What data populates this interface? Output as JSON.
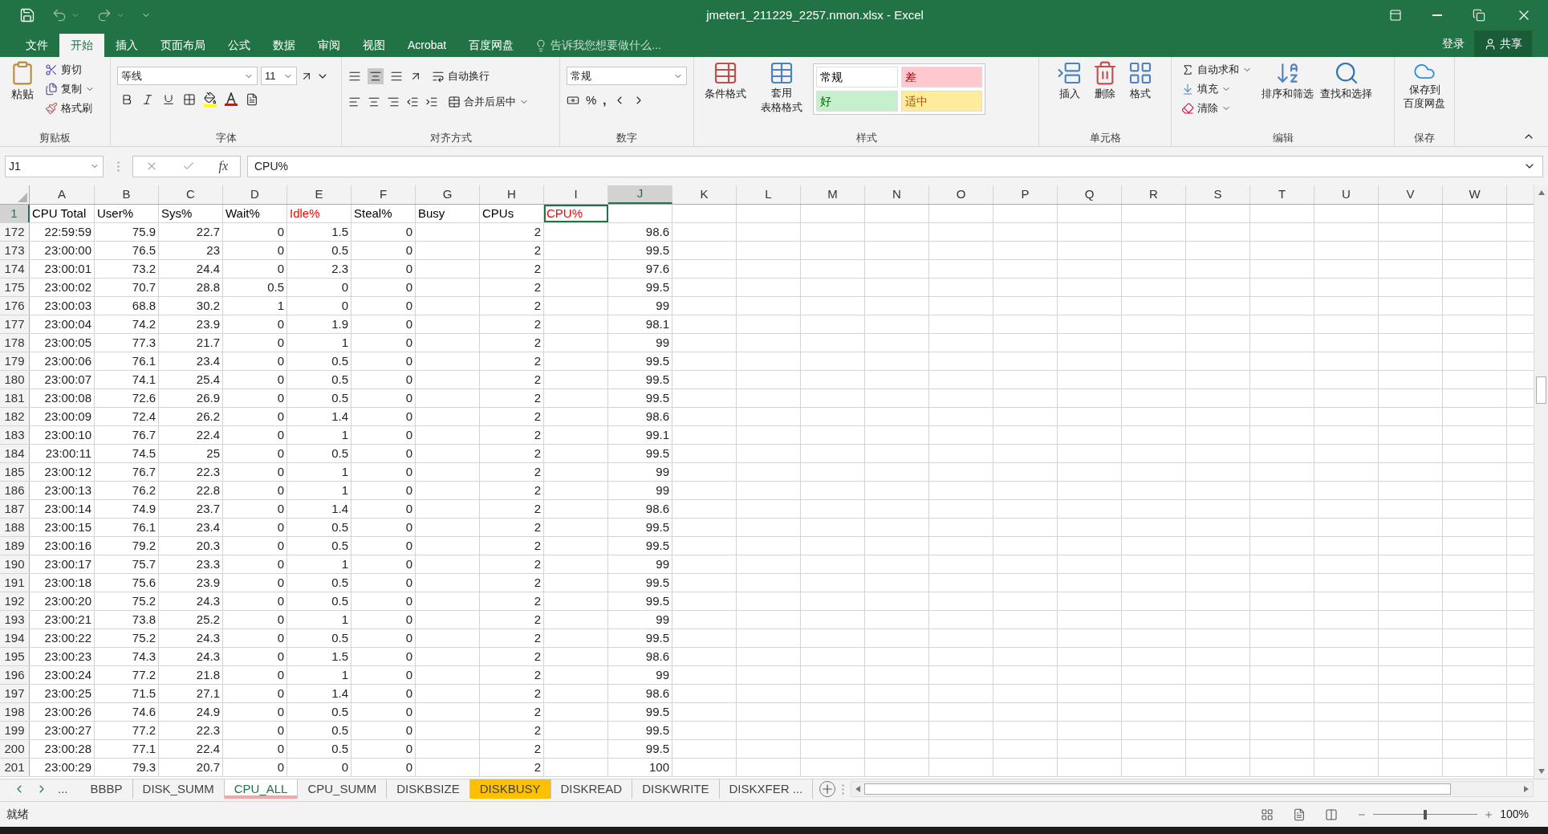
{
  "window": {
    "title": "jmeter1_211229_2257.nmon.xlsx - Excel"
  },
  "menu_tabs": [
    {
      "label": "文件",
      "selected": false
    },
    {
      "label": "开始",
      "selected": true
    },
    {
      "label": "插入",
      "selected": false
    },
    {
      "label": "页面布局",
      "selected": false
    },
    {
      "label": "公式",
      "selected": false
    },
    {
      "label": "数据",
      "selected": false
    },
    {
      "label": "审阅",
      "selected": false
    },
    {
      "label": "视图",
      "selected": false
    },
    {
      "label": "Acrobat",
      "selected": false
    },
    {
      "label": "百度网盘",
      "selected": false
    }
  ],
  "tell_me": {
    "placeholder": "告诉我您想要做什么..."
  },
  "account": {
    "sign_in": "登录",
    "share": "共享"
  },
  "ribbon": {
    "clipboard": {
      "paste": "粘贴",
      "cut": "剪切",
      "copy": "复制",
      "format_painter": "格式刷",
      "label": "剪贴板"
    },
    "font": {
      "name": "等线",
      "size": "11",
      "label": "字体"
    },
    "alignment": {
      "wrap": "自动换行",
      "merge": "合并后居中",
      "label": "对齐方式"
    },
    "number": {
      "format": "常规",
      "percent": "%",
      "comma": ",",
      "label": "数字"
    },
    "styles": {
      "conditional": "条件格式",
      "table": [
        "套用",
        "表格格式"
      ],
      "label": "样式",
      "cells": [
        {
          "label": "常规",
          "color": "#ffffff"
        },
        {
          "label": "差",
          "color": "#ffc7ce"
        },
        {
          "label": "好",
          "color": "#c6efce"
        },
        {
          "label": "适中",
          "color": "#ffeb9c"
        }
      ]
    },
    "cells": {
      "insert": "插入",
      "delete": "删除",
      "format": "格式",
      "label": "单元格"
    },
    "editing": {
      "autosum": "自动求和",
      "fill": "填充",
      "clear": "清除",
      "sort": "排序和筛选",
      "find": "查找和选择",
      "label": "编辑"
    },
    "save": {
      "button": [
        "保存到",
        "百度网盘"
      ],
      "label": "保存"
    }
  },
  "formula_bar": {
    "name_box": "J1",
    "fx": "fx",
    "value": "CPU%"
  },
  "sheet": {
    "columns": [
      {
        "label": "A",
        "selected": false
      },
      {
        "label": "B",
        "selected": false
      },
      {
        "label": "C",
        "selected": false
      },
      {
        "label": "D",
        "selected": false
      },
      {
        "label": "E",
        "selected": false
      },
      {
        "label": "F",
        "selected": false
      },
      {
        "label": "G",
        "selected": false
      },
      {
        "label": "H",
        "selected": false
      },
      {
        "label": "I",
        "selected": false
      },
      {
        "label": "J",
        "selected": true
      },
      {
        "label": "K",
        "selected": false
      },
      {
        "label": "L",
        "selected": false
      },
      {
        "label": "M",
        "selected": false
      },
      {
        "label": "N",
        "selected": false
      },
      {
        "label": "O",
        "selected": false
      },
      {
        "label": "P",
        "selected": false
      },
      {
        "label": "Q",
        "selected": false
      },
      {
        "label": "R",
        "selected": false
      },
      {
        "label": "S",
        "selected": false
      },
      {
        "label": "T",
        "selected": false
      },
      {
        "label": "U",
        "selected": false
      },
      {
        "label": "V",
        "selected": false
      },
      {
        "label": "W",
        "selected": false
      }
    ],
    "header_row": {
      "number": "1",
      "cells": [
        {
          "text": "CPU Total",
          "color": "#000000",
          "selected": false
        },
        {
          "text": "User%",
          "color": "#000000",
          "selected": false
        },
        {
          "text": "Sys%",
          "color": "#000000",
          "selected": false
        },
        {
          "text": "Wait%",
          "color": "#000000",
          "selected": false
        },
        {
          "text": "Idle%",
          "color": "#ff0000",
          "selected": false
        },
        {
          "text": "Steal%",
          "color": "#000000",
          "selected": false
        },
        {
          "text": "Busy",
          "color": "#000000",
          "selected": false
        },
        {
          "text": "CPUs",
          "color": "#000000",
          "selected": false
        },
        {
          "text": "CPU%",
          "color": "#ff0000",
          "selected": true
        }
      ]
    },
    "rows": [
      {
        "number": "172",
        "cells": [
          "22:59:59",
          "75.9",
          "22.7",
          "0",
          "1.5",
          "0",
          "2",
          "98.6"
        ]
      },
      {
        "number": "173",
        "cells": [
          "23:00:00",
          "76.5",
          "23",
          "0",
          "0.5",
          "0",
          "2",
          "99.5"
        ]
      },
      {
        "number": "174",
        "cells": [
          "23:00:01",
          "73.2",
          "24.4",
          "0",
          "2.3",
          "0",
          "2",
          "97.6"
        ]
      },
      {
        "number": "175",
        "cells": [
          "23:00:02",
          "70.7",
          "28.8",
          "0.5",
          "0",
          "0",
          "2",
          "99.5"
        ]
      },
      {
        "number": "176",
        "cells": [
          "23:00:03",
          "68.8",
          "30.2",
          "1",
          "0",
          "0",
          "2",
          "99"
        ]
      },
      {
        "number": "177",
        "cells": [
          "23:00:04",
          "74.2",
          "23.9",
          "0",
          "1.9",
          "0",
          "2",
          "98.1"
        ]
      },
      {
        "number": "178",
        "cells": [
          "23:00:05",
          "77.3",
          "21.7",
          "0",
          "1",
          "0",
          "2",
          "99"
        ]
      },
      {
        "number": "179",
        "cells": [
          "23:00:06",
          "76.1",
          "23.4",
          "0",
          "0.5",
          "0",
          "2",
          "99.5"
        ]
      },
      {
        "number": "180",
        "cells": [
          "23:00:07",
          "74.1",
          "25.4",
          "0",
          "0.5",
          "0",
          "2",
          "99.5"
        ]
      },
      {
        "number": "181",
        "cells": [
          "23:00:08",
          "72.6",
          "26.9",
          "0",
          "0.5",
          "0",
          "2",
          "99.5"
        ]
      },
      {
        "number": "182",
        "cells": [
          "23:00:09",
          "72.4",
          "26.2",
          "0",
          "1.4",
          "0",
          "2",
          "98.6"
        ]
      },
      {
        "number": "183",
        "cells": [
          "23:00:10",
          "76.7",
          "22.4",
          "0",
          "1",
          "0",
          "2",
          "99.1"
        ]
      },
      {
        "number": "184",
        "cells": [
          "23:00:11",
          "74.5",
          "25",
          "0",
          "0.5",
          "0",
          "2",
          "99.5"
        ]
      },
      {
        "number": "185",
        "cells": [
          "23:00:12",
          "76.7",
          "22.3",
          "0",
          "1",
          "0",
          "2",
          "99"
        ]
      },
      {
        "number": "186",
        "cells": [
          "23:00:13",
          "76.2",
          "22.8",
          "0",
          "1",
          "0",
          "2",
          "99"
        ]
      },
      {
        "number": "187",
        "cells": [
          "23:00:14",
          "74.9",
          "23.7",
          "0",
          "1.4",
          "0",
          "2",
          "98.6"
        ]
      },
      {
        "number": "188",
        "cells": [
          "23:00:15",
          "76.1",
          "23.4",
          "0",
          "0.5",
          "0",
          "2",
          "99.5"
        ]
      },
      {
        "number": "189",
        "cells": [
          "23:00:16",
          "79.2",
          "20.3",
          "0",
          "0.5",
          "0",
          "2",
          "99.5"
        ]
      },
      {
        "number": "190",
        "cells": [
          "23:00:17",
          "75.7",
          "23.3",
          "0",
          "1",
          "0",
          "2",
          "99"
        ]
      },
      {
        "number": "191",
        "cells": [
          "23:00:18",
          "75.6",
          "23.9",
          "0",
          "0.5",
          "0",
          "2",
          "99.5"
        ]
      },
      {
        "number": "192",
        "cells": [
          "23:00:20",
          "75.2",
          "24.3",
          "0",
          "0.5",
          "0",
          "2",
          "99.5"
        ]
      },
      {
        "number": "193",
        "cells": [
          "23:00:21",
          "73.8",
          "25.2",
          "0",
          "1",
          "0",
          "2",
          "99"
        ]
      },
      {
        "number": "194",
        "cells": [
          "23:00:22",
          "75.2",
          "24.3",
          "0",
          "0.5",
          "0",
          "2",
          "99.5"
        ]
      },
      {
        "number": "195",
        "cells": [
          "23:00:23",
          "74.3",
          "24.3",
          "0",
          "1.5",
          "0",
          "2",
          "98.6"
        ]
      },
      {
        "number": "196",
        "cells": [
          "23:00:24",
          "77.2",
          "21.8",
          "0",
          "1",
          "0",
          "2",
          "99"
        ]
      },
      {
        "number": "197",
        "cells": [
          "23:00:25",
          "71.5",
          "27.1",
          "0",
          "1.4",
          "0",
          "2",
          "98.6"
        ]
      },
      {
        "number": "198",
        "cells": [
          "23:00:26",
          "74.6",
          "24.9",
          "0",
          "0.5",
          "0",
          "2",
          "99.5"
        ]
      },
      {
        "number": "199",
        "cells": [
          "23:00:27",
          "77.2",
          "22.3",
          "0",
          "0.5",
          "0",
          "2",
          "99.5"
        ]
      },
      {
        "number": "200",
        "cells": [
          "23:00:28",
          "77.1",
          "22.4",
          "0",
          "0.5",
          "0",
          "2",
          "99.5"
        ]
      },
      {
        "number": "201",
        "cells": [
          "23:00:29",
          "79.3",
          "20.7",
          "0",
          "0",
          "0",
          "2",
          "100"
        ]
      }
    ]
  },
  "sheet_tabs": {
    "more": "...",
    "tabs": [
      {
        "label": "BBBP",
        "selected": false
      },
      {
        "label": "DISK_SUMM",
        "selected": false
      },
      {
        "label": "CPU_ALL",
        "selected": true,
        "color": "#f4a6a6"
      },
      {
        "label": "CPU_SUMM",
        "selected": false
      },
      {
        "label": "DISKBSIZE",
        "selected": false
      },
      {
        "label": "DISKBUSY",
        "selected": false,
        "color": "#ffc000"
      },
      {
        "label": "DISKREAD",
        "selected": false
      },
      {
        "label": "DISKWRITE",
        "selected": false
      },
      {
        "label": "DISKXFER ...",
        "selected": false
      }
    ]
  },
  "status_bar": {
    "ready": "就绪",
    "zoom": "100%",
    "zoom_slider": {
      "level": 0.5
    }
  }
}
